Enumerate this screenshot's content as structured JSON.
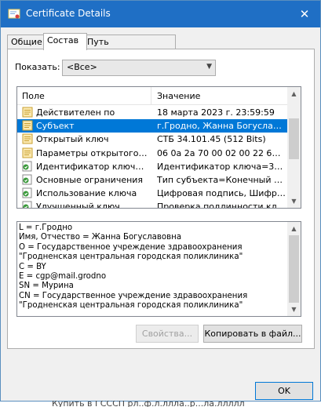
{
  "window": {
    "title": "Certificate Details",
    "close_glyph": "✕"
  },
  "tabs": [
    {
      "label": "Общие"
    },
    {
      "label": "Состав"
    },
    {
      "label": "Путь сертификации"
    }
  ],
  "show": {
    "label": "Показать:",
    "value": "<Все>"
  },
  "fields_list": {
    "col_field": "Поле",
    "col_value": "Значение",
    "rows": [
      {
        "field": "Действителен по",
        "value": "18 марта 2023 г. 23:59:59",
        "icon": "doc-field-icon"
      },
      {
        "field": "Субъект",
        "value": "г.Гродно, Жанна Богуславо...",
        "icon": "doc-field-icon",
        "selected": true
      },
      {
        "field": "Открытый ключ",
        "value": "СТБ 34.101.45 (512 Bits)",
        "icon": "doc-field-icon"
      },
      {
        "field": "Параметры открытого клю...",
        "value": "06 0a 2a 70 00 02 00 22 65 2d...",
        "icon": "doc-field-icon"
      },
      {
        "field": "Идентификатор ключа це...",
        "value": "Идентификатор ключа=395...",
        "icon": "extension-icon"
      },
      {
        "field": "Основные ограничения",
        "value": "Тип субъекта=Конечный су...",
        "icon": "extension-icon"
      },
      {
        "field": "Использование ключа",
        "value": "Цифровая подпись, Шифров...",
        "icon": "extension-icon"
      },
      {
        "field": "Улучшенный ключ",
        "value": "Проверка подлинности клиен...",
        "icon": "extension-icon"
      }
    ]
  },
  "detail_lines": [
    "L = г.Гродно",
    "Имя, Отчество = Жанна Богуславовна",
    "O = Государственное учреждение здравоохранения",
    "\"Гродненская центральная городская поликлиника\"",
    "C = BY",
    "E = cgp@mail.grodno",
    "SN = Мурина",
    "CN = Государственное учреждение здравоохранения",
    "\"Гродненская центральная городская поликлиника\""
  ],
  "buttons": {
    "properties": "Свойства...",
    "copy_to_file": "Копировать в файл...",
    "ok": "OK"
  },
  "underlay_text": "Купить в ГСССП рл..ф.л.ллла..р...ла.ллллл"
}
